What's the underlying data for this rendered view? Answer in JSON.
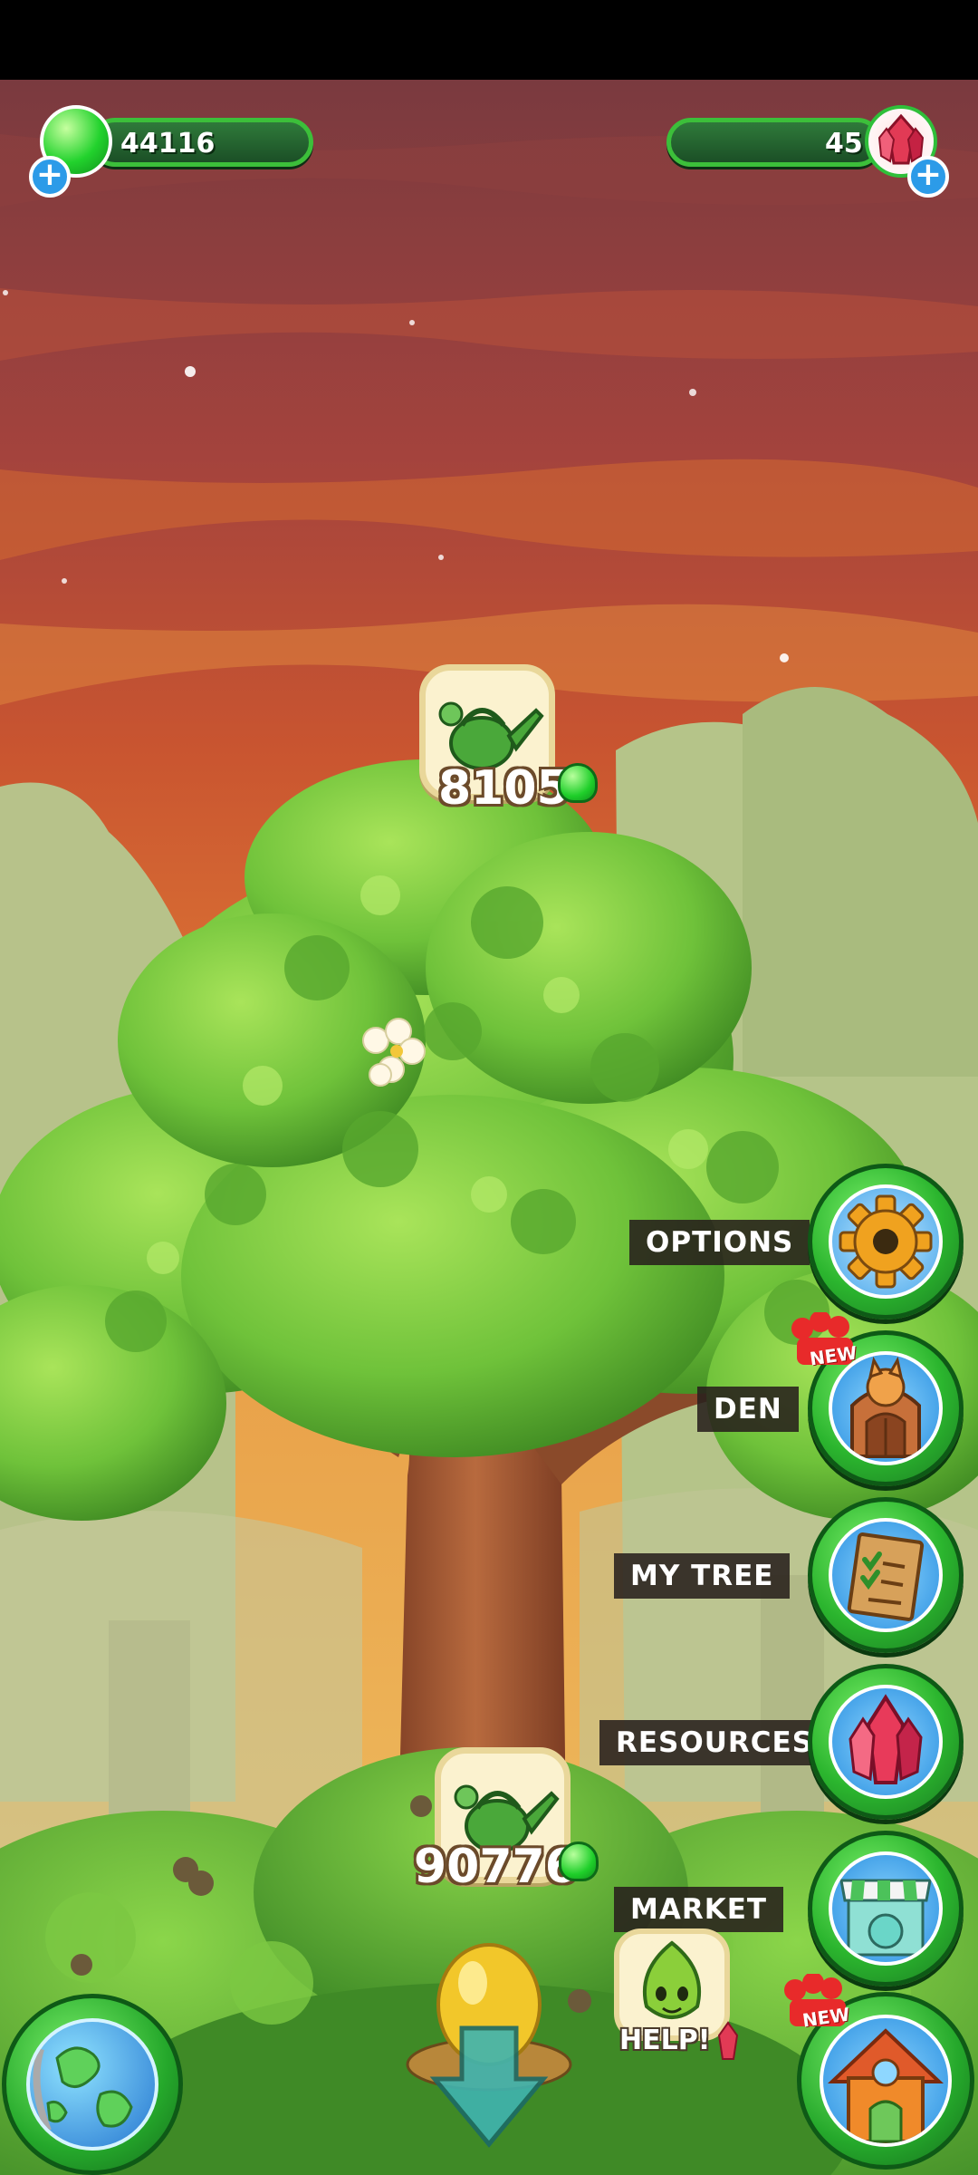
{
  "hud": {
    "jelly_count": "44116",
    "gem_count": "45"
  },
  "tree": {
    "top_water_cost": "8105",
    "bottom_water_cost": "90776"
  },
  "menu": {
    "options_label": "OPTIONS",
    "den_label": "DEN",
    "mytree_label": "MY TREE",
    "resources_label": "RESOURCES",
    "market_label": "MARKET",
    "new_badge": "NEW"
  },
  "help": {
    "label": "HELP!"
  },
  "colors": {
    "sky_top": "#7a3a3f",
    "sky_bottom": "#e08a3a",
    "foliage": "#6fc23a",
    "button_green": "#2bb52e",
    "label_bg": "#28201c"
  },
  "icons": [
    "jelly-icon",
    "gem-icon",
    "plus-icon",
    "watering-can-icon",
    "gear-icon",
    "den-icon",
    "checklist-icon",
    "crystal-icon",
    "market-icon",
    "globe-icon",
    "house-icon",
    "golden-egg-icon",
    "down-arrow-icon",
    "leaf-sprite-icon"
  ]
}
